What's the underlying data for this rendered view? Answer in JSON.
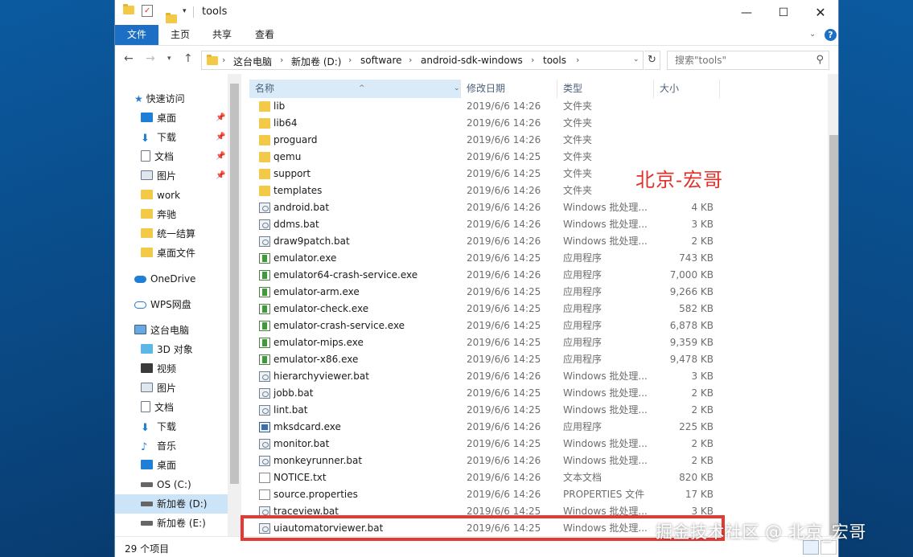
{
  "title": "tools",
  "ribbon": {
    "tabs": [
      {
        "label": "文件",
        "active": true
      },
      {
        "label": "主页"
      },
      {
        "label": "共享"
      },
      {
        "label": "查看"
      }
    ]
  },
  "breadcrumbs": [
    "这台电脑",
    "新加卷 (D:)",
    "software",
    "android-sdk-windows",
    "tools"
  ],
  "search": {
    "placeholder": "搜索\"tools\""
  },
  "nav": {
    "quick_access": "快速访问",
    "items": [
      {
        "label": "桌面"
      },
      {
        "label": "下载"
      },
      {
        "label": "文档"
      },
      {
        "label": "图片"
      },
      {
        "label": "work"
      },
      {
        "label": "奔驰"
      },
      {
        "label": "统一结算"
      },
      {
        "label": "桌面文件"
      }
    ],
    "onedrive": "OneDrive",
    "wps": "WPS网盘",
    "this_pc": "这台电脑",
    "pc_items": [
      {
        "label": "3D 对象"
      },
      {
        "label": "视频"
      },
      {
        "label": "图片"
      },
      {
        "label": "文档"
      },
      {
        "label": "下载"
      },
      {
        "label": "音乐"
      },
      {
        "label": "桌面"
      },
      {
        "label": "OS (C:)"
      },
      {
        "label": "新加卷 (D:)"
      },
      {
        "label": "新加卷 (E:)"
      }
    ]
  },
  "columns": {
    "name": "名称",
    "date": "修改日期",
    "type": "类型",
    "size": "大小"
  },
  "files": [
    {
      "name": "lib",
      "date": "2019/6/6 14:26",
      "type": "文件夹",
      "size": "",
      "icon": "folder"
    },
    {
      "name": "lib64",
      "date": "2019/6/6 14:26",
      "type": "文件夹",
      "size": "",
      "icon": "folder"
    },
    {
      "name": "proguard",
      "date": "2019/6/6 14:26",
      "type": "文件夹",
      "size": "",
      "icon": "folder"
    },
    {
      "name": "qemu",
      "date": "2019/6/6 14:25",
      "type": "文件夹",
      "size": "",
      "icon": "folder"
    },
    {
      "name": "support",
      "date": "2019/6/6 14:25",
      "type": "文件夹",
      "size": "",
      "icon": "folder"
    },
    {
      "name": "templates",
      "date": "2019/6/6 14:26",
      "type": "文件夹",
      "size": "",
      "icon": "folder"
    },
    {
      "name": "android.bat",
      "date": "2019/6/6 14:26",
      "type": "Windows 批处理...",
      "size": "4 KB",
      "icon": "bat"
    },
    {
      "name": "ddms.bat",
      "date": "2019/6/6 14:26",
      "type": "Windows 批处理...",
      "size": "3 KB",
      "icon": "bat"
    },
    {
      "name": "draw9patch.bat",
      "date": "2019/6/6 14:26",
      "type": "Windows 批处理...",
      "size": "2 KB",
      "icon": "bat"
    },
    {
      "name": "emulator.exe",
      "date": "2019/6/6 14:25",
      "type": "应用程序",
      "size": "743 KB",
      "icon": "exe"
    },
    {
      "name": "emulator64-crash-service.exe",
      "date": "2019/6/6 14:26",
      "type": "应用程序",
      "size": "7,000 KB",
      "icon": "exe"
    },
    {
      "name": "emulator-arm.exe",
      "date": "2019/6/6 14:25",
      "type": "应用程序",
      "size": "9,266 KB",
      "icon": "exe"
    },
    {
      "name": "emulator-check.exe",
      "date": "2019/6/6 14:25",
      "type": "应用程序",
      "size": "582 KB",
      "icon": "exe"
    },
    {
      "name": "emulator-crash-service.exe",
      "date": "2019/6/6 14:25",
      "type": "应用程序",
      "size": "6,878 KB",
      "icon": "exe"
    },
    {
      "name": "emulator-mips.exe",
      "date": "2019/6/6 14:25",
      "type": "应用程序",
      "size": "9,359 KB",
      "icon": "exe"
    },
    {
      "name": "emulator-x86.exe",
      "date": "2019/6/6 14:25",
      "type": "应用程序",
      "size": "9,478 KB",
      "icon": "exe"
    },
    {
      "name": "hierarchyviewer.bat",
      "date": "2019/6/6 14:26",
      "type": "Windows 批处理...",
      "size": "3 KB",
      "icon": "bat"
    },
    {
      "name": "jobb.bat",
      "date": "2019/6/6 14:25",
      "type": "Windows 批处理...",
      "size": "2 KB",
      "icon": "bat"
    },
    {
      "name": "lint.bat",
      "date": "2019/6/6 14:25",
      "type": "Windows 批处理...",
      "size": "2 KB",
      "icon": "bat"
    },
    {
      "name": "mksdcard.exe",
      "date": "2019/6/6 14:26",
      "type": "应用程序",
      "size": "225 KB",
      "icon": "exe2"
    },
    {
      "name": "monitor.bat",
      "date": "2019/6/6 14:25",
      "type": "Windows 批处理...",
      "size": "2 KB",
      "icon": "bat"
    },
    {
      "name": "monkeyrunner.bat",
      "date": "2019/6/6 14:26",
      "type": "Windows 批处理...",
      "size": "2 KB",
      "icon": "bat"
    },
    {
      "name": "NOTICE.txt",
      "date": "2019/6/6 14:26",
      "type": "文本文档",
      "size": "820 KB",
      "icon": "txt"
    },
    {
      "name": "source.properties",
      "date": "2019/6/6 14:26",
      "type": "PROPERTIES 文件",
      "size": "17 KB",
      "icon": "txt"
    },
    {
      "name": "traceview.bat",
      "date": "2019/6/6 14:25",
      "type": "Windows 批处理...",
      "size": "3 KB",
      "icon": "bat"
    },
    {
      "name": "uiautomatorviewer.bat",
      "date": "2019/6/6 14:25",
      "type": "Windows 批处理...",
      "size": "",
      "icon": "bat"
    }
  ],
  "status": "29 个项目",
  "overlay_author": "北京-宏哥",
  "watermark": "掘金技术社区 @ 北京_宏哥",
  "colors": {
    "accent": "#1c6fc5",
    "highlight": "#e53935",
    "author": "#e2302b"
  }
}
